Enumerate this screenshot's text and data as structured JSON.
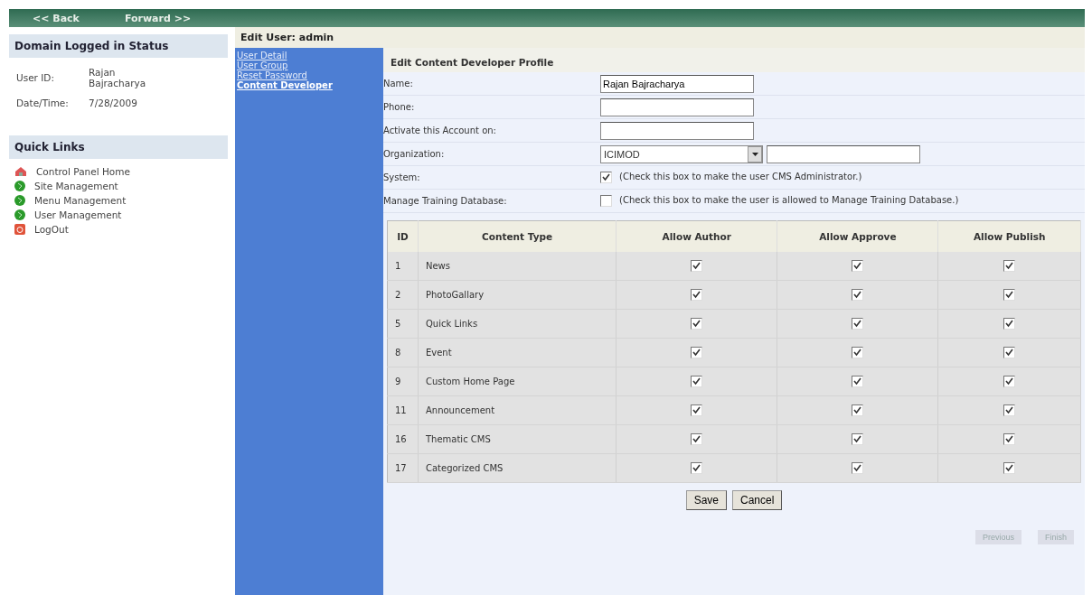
{
  "nav": [
    {
      "label": "<< Back"
    },
    {
      "label": "Forward >>"
    }
  ],
  "status_panel": {
    "title": "Domain Logged in Status",
    "rows": [
      {
        "label": "User ID:",
        "value": "Rajan Bajracharya"
      },
      {
        "label": "Date/Time:",
        "value": "7/28/2009"
      }
    ]
  },
  "quick_links": {
    "title": "Quick Links",
    "items": [
      {
        "label": "Control Panel Home",
        "kind": "home"
      },
      {
        "label": "Site Management",
        "kind": "manage"
      },
      {
        "label": "Menu Management",
        "kind": "manage"
      },
      {
        "label": "User Management",
        "kind": "manage"
      },
      {
        "label": "LogOut",
        "kind": "logout"
      }
    ]
  },
  "page_title": "Edit User: admin",
  "sidebar": {
    "items": [
      {
        "label": "User Detail",
        "selected": false
      },
      {
        "label": "User Group",
        "selected": false
      },
      {
        "label": "Reset Password",
        "selected": false
      },
      {
        "label": "Content Developer",
        "selected": true
      }
    ]
  },
  "form": {
    "title": "Edit Content Developer Profile",
    "fields": [
      {
        "label": "Name:",
        "kind": "text",
        "value": "Rajan Bajracharya"
      },
      {
        "label": "Phone:",
        "kind": "text"
      },
      {
        "label": "Activate this Account on:",
        "kind": "text"
      },
      {
        "label": "Organization:",
        "kind": "select",
        "value": "ICIMOD"
      },
      {
        "label": "System:",
        "kind": "checkbox",
        "checked": true,
        "note": "(Check this box to make the user CMS Administrator.)"
      },
      {
        "label": "Manage Training Database:",
        "kind": "checkbox",
        "checked": false,
        "note": "(Check this box to make the user is allowed to Manage Training Database.)"
      }
    ]
  },
  "table": {
    "columns": [
      "ID",
      "Content Type",
      "Allow Author",
      "Allow Approve",
      "Allow Publish"
    ],
    "rows": [
      {
        "id": "1",
        "type": "News",
        "author": true,
        "approve": true,
        "publish": true
      },
      {
        "id": "2",
        "type": "PhotoGallary",
        "author": true,
        "approve": true,
        "publish": true
      },
      {
        "id": "5",
        "type": "Quick Links",
        "author": true,
        "approve": true,
        "publish": true
      },
      {
        "id": "8",
        "type": "Event",
        "author": true,
        "approve": true,
        "publish": true
      },
      {
        "id": "9",
        "type": "Custom Home Page",
        "author": true,
        "approve": true,
        "publish": true
      },
      {
        "id": "11",
        "type": "Announcement",
        "author": true,
        "approve": true,
        "publish": true
      },
      {
        "id": "16",
        "type": "Thematic CMS",
        "author": true,
        "approve": true,
        "publish": true
      },
      {
        "id": "17",
        "type": "Categorized CMS",
        "author": true,
        "approve": true,
        "publish": true
      }
    ]
  },
  "buttons": [
    "Save",
    "Cancel"
  ],
  "wizard_buttons": [
    {
      "label": "Previous",
      "disabled": true
    },
    {
      "label": "Finish",
      "disabled": true
    }
  ]
}
